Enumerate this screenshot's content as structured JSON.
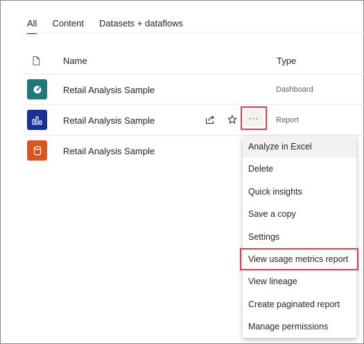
{
  "tabs": [
    {
      "label": "All",
      "active": true
    },
    {
      "label": "Content",
      "active": false
    },
    {
      "label": "Datasets + dataflows",
      "active": false
    }
  ],
  "columns": {
    "name": "Name",
    "type": "Type"
  },
  "rows": [
    {
      "name": "Retail Analysis Sample",
      "type": "Dashboard",
      "icon": "dashboard-icon",
      "color": "#1e7a7a"
    },
    {
      "name": "Retail Analysis Sample",
      "type": "Report",
      "icon": "report-icon",
      "color": "#1b2f99"
    },
    {
      "name": "Retail Analysis Sample",
      "type": "",
      "icon": "dataset-icon",
      "color": "#d9541e"
    }
  ],
  "more_label": "···",
  "menu": {
    "items": [
      "Analyze in Excel",
      "Delete",
      "Quick insights",
      "Save a copy",
      "Settings",
      "View usage metrics report",
      "View lineage",
      "Create paginated report",
      "Manage permissions"
    ],
    "hovered_index": 0,
    "highlighted_index": 5
  },
  "colors": {
    "highlight": "#e0404a",
    "hover": "#f3f2f1"
  }
}
